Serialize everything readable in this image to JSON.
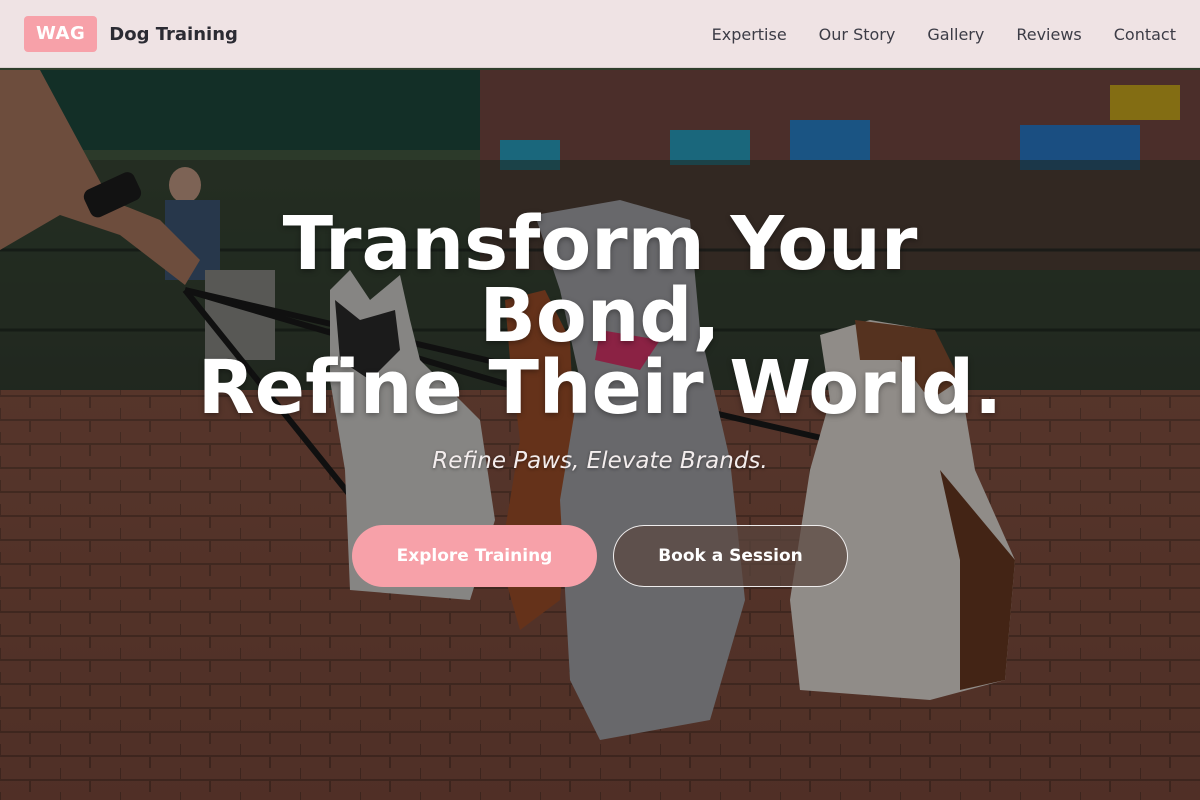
{
  "header": {
    "logo_badge": "WAG",
    "brand_name": "Dog Training",
    "nav": [
      {
        "label": "Expertise"
      },
      {
        "label": "Our Story"
      },
      {
        "label": "Gallery"
      },
      {
        "label": "Reviews"
      },
      {
        "label": "Contact"
      }
    ]
  },
  "hero": {
    "headline_line1": "Transform Your",
    "headline_line2": "Bond,",
    "headline_line3": "Refine Their World.",
    "subheadline": "Refine Paws, Elevate Brands.",
    "primary_cta": "Explore Training",
    "secondary_cta": "Book a Session"
  },
  "colors": {
    "accent": "#f7a1a9",
    "header_bg": "#faecee",
    "text_dark": "#2b2b33"
  },
  "icons": {
    "hero_background": "dogs-on-leash-photo"
  }
}
